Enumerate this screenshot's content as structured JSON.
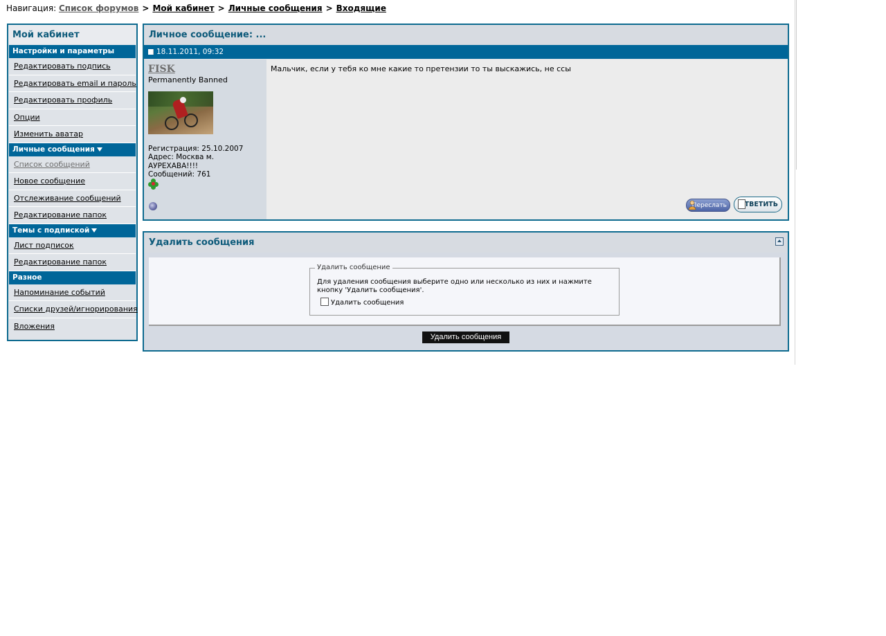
{
  "breadcrumb": {
    "prefix": "Навигация:",
    "items": [
      "Список форумов",
      "Мой кабинет",
      "Личные сообщения",
      "Входящие"
    ],
    "separator": ">"
  },
  "sidebar": {
    "title": "Мой кабинет",
    "sections": [
      {
        "heading": "Настройки и параметры",
        "items": [
          "Редактировать подпись",
          "Редактировать email и пароль",
          "Редактировать профиль",
          "Опции",
          "Изменить аватар"
        ]
      },
      {
        "heading": "Личные сообщения",
        "items": [
          "Список сообщений",
          "Новое сообщение",
          "Отслеживание сообщений",
          "Редактирование папок"
        ]
      },
      {
        "heading": "Темы с подпиской",
        "items": [
          "Лист подписок",
          "Редактирование папок"
        ]
      },
      {
        "heading": "Разное",
        "items": [
          "Напоминание событий",
          "Списки друзей/игнорирования",
          "Вложения"
        ]
      }
    ]
  },
  "message": {
    "panel_title": "Личное сообщение: ...",
    "date": "18.11.2011, 09:32",
    "user": {
      "name": "FISK",
      "title": "Permanently Banned",
      "registration": "Регистрация: 25.10.2007",
      "address_line1": "Адрес: Москва м.",
      "address_line2": "АУРЕХАВА!!!!",
      "posts": "Сообщений: 761"
    },
    "text": "Мальчик, если у тебя ко мне какие то претензии то ты выскажись, не ссы",
    "forward_label": "Переслать",
    "reply_label": "ОТВЕТИТЬ"
  },
  "delete_panel": {
    "title": "Удалить сообщения",
    "fieldset_legend": "Удалить сообщение",
    "description": "Для удаления сообщения выберите одно или несколько из них и нажмите кнопку 'Удалить сообщения'.",
    "checkbox_label": "Удалить сообщения",
    "submit_label": "Удалить сообщения"
  },
  "colors": {
    "accent": "#006699",
    "panel_border": "#0d6a8f",
    "title_text": "#0d5a7a"
  }
}
